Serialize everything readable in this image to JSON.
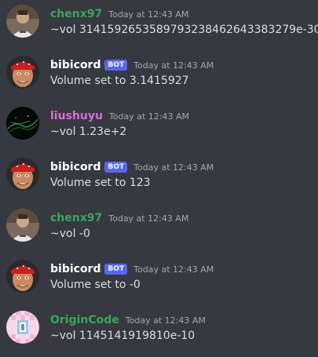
{
  "colors": {
    "background": "#36393f",
    "text": "#dcddde",
    "timestamp": "#a3a6aa",
    "bot_tag": "#5865f2"
  },
  "messages": [
    {
      "username": "chenx97",
      "username_color": "#3ba55d",
      "avatar": "chenx97-avatar",
      "bot": false,
      "timestamp": "Today at 12:43 AM",
      "text": "~vol 3141592653589793238462643383279e-30"
    },
    {
      "username": "bibicord",
      "username_color": "#ffffff",
      "avatar": "bibicord-avatar",
      "bot": true,
      "bot_label": "BOT",
      "timestamp": "Today at 12:43 AM",
      "text": "Volume set to 3.1415927"
    },
    {
      "username": "liushuyu",
      "username_color": "#d86fd6",
      "avatar": "liushuyu-avatar",
      "bot": false,
      "timestamp": "Today at 12:43 AM",
      "text": "~vol 1.23e+2"
    },
    {
      "username": "bibicord",
      "username_color": "#ffffff",
      "avatar": "bibicord-avatar",
      "bot": true,
      "bot_label": "BOT",
      "timestamp": "Today at 12:43 AM",
      "text": "Volume set to 123"
    },
    {
      "username": "chenx97",
      "username_color": "#3ba55d",
      "avatar": "chenx97-avatar",
      "bot": false,
      "timestamp": "Today at 12:43 AM",
      "text": "~vol -0"
    },
    {
      "username": "bibicord",
      "username_color": "#ffffff",
      "avatar": "bibicord-avatar",
      "bot": true,
      "bot_label": "BOT",
      "timestamp": "Today at 12:43 AM",
      "text": "Volume set to -0"
    },
    {
      "username": "OriginCode",
      "username_color": "#3ba55d",
      "avatar": "origincode-avatar",
      "bot": false,
      "timestamp": "Today at 12:43 AM",
      "text": "~vol 1145141919810e-10"
    }
  ]
}
